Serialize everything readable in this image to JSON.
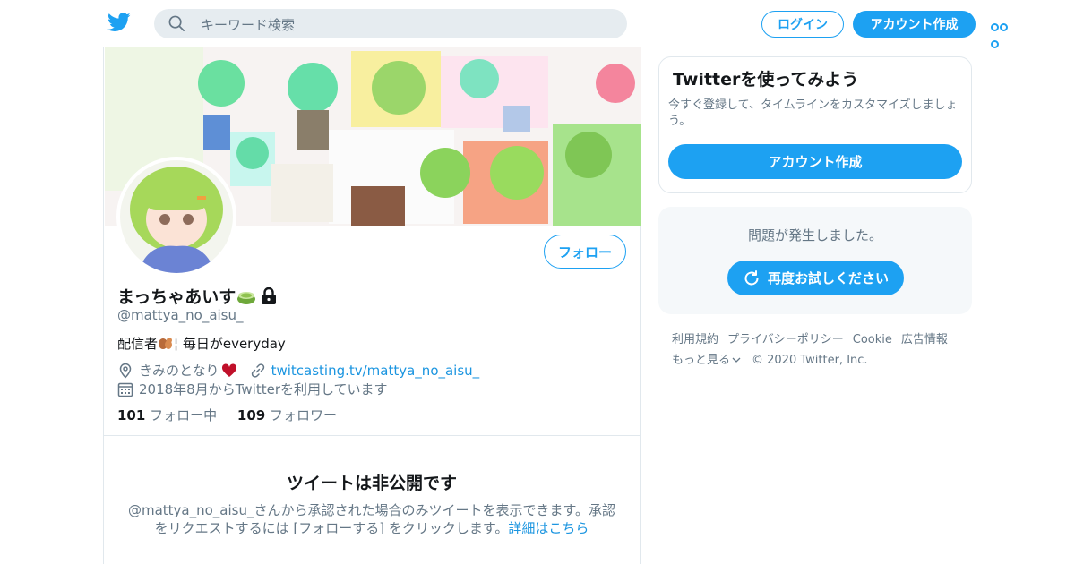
{
  "header": {
    "search_placeholder": "キーワード検索",
    "login": "ログイン",
    "signup": "アカウント作成"
  },
  "profile": {
    "name": "まっちゃあいす",
    "handle": "@mattya_no_aisu_",
    "bio_prefix": "配信者",
    "bio_suffix": "¦ 毎日がeveryday",
    "location": "きみのとなり",
    "url": "twitcasting.tv/mattya_no_aisu_",
    "joined": "2018年8月からTwitterを利用しています",
    "following_count": "101",
    "following_label": "フォロー中",
    "followers_count": "109",
    "followers_label": "フォロワー",
    "follow_button": "フォロー"
  },
  "protected": {
    "title": "ツイートは非公開です",
    "text": "@mattya_no_aisu_さんから承認された場合のみツイートを表示できます。承認をリクエストするには [フォローする] をクリックします。",
    "link": "詳細はこちら"
  },
  "sidebar": {
    "signup_card": {
      "title": "Twitterを使ってみよう",
      "text": "今すぐ登録して、タイムラインをカスタマイズしましょう。",
      "button": "アカウント作成"
    },
    "error_card": {
      "text": "問題が発生しました。",
      "button": "再度お試しください"
    },
    "footer": {
      "links": [
        "利用規約",
        "プライバシーポリシー",
        "Cookie",
        "広告情報"
      ],
      "more": "もっと見る",
      "copyright": "© 2020 Twitter, Inc."
    }
  },
  "colors": {
    "accent": "#1da1f2",
    "link": "#1b95e0",
    "secondary_text": "#657786",
    "border": "#e1e8ed"
  },
  "icons": [
    "twitter-bird-icon",
    "search-icon",
    "more-dots-icon",
    "lock-icon",
    "location-icon",
    "link-icon",
    "calendar-icon",
    "refresh-icon",
    "chevron-down-icon",
    "heart-icon",
    "squirrel-emoji",
    "matcha-emoji"
  ]
}
